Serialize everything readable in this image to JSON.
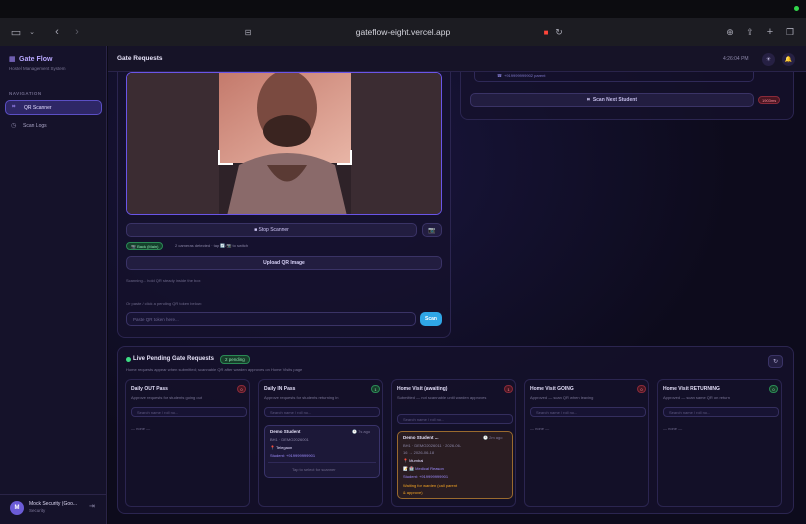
{
  "browser": {
    "url": "gateflow-eight.vercel.app"
  },
  "sidebar": {
    "brand": "Gate Flow",
    "brand_sub": "Hostel Management System",
    "nav_label": "NAVIGATION",
    "items": [
      {
        "label": "QR Scanner",
        "icon": "qr-icon",
        "active": true
      },
      {
        "label": "Scan Logs",
        "icon": "clock-icon",
        "active": false
      }
    ],
    "user": {
      "initial": "M",
      "name": "Mock Security (Goo...",
      "role": "Security"
    }
  },
  "header": {
    "title": "Gate Requests",
    "time": "4:26:04 PM"
  },
  "scanner": {
    "stop_label": "■ Stop Scanner",
    "camera_badge": "📷 Back (Main)",
    "camera_info": "2 cameras detected · tap 🔄/📷 to switch",
    "upload_label": "Upload QR Image",
    "hint": "Scanning... hold QR steady inside the box",
    "paste_label": "Or paste / click a pending QR token below:",
    "token_placeholder": "Paste QR token here...",
    "scan_label": "Scan"
  },
  "result": {
    "parent_line": "+919999999902 parent",
    "next_label": "Scan Next Student",
    "timer": "1903ms"
  },
  "live": {
    "title": "Live Pending Gate Requests",
    "badge": "2 pending",
    "subtitle": "Home requests appear when submitted; scannable QR after warden approves on Home Visits page",
    "columns": [
      {
        "title": "Daily OUT Pass",
        "count": "0",
        "sub": "Approve requests for students going out",
        "search": "Search name / roll no...",
        "empty": "— none —"
      },
      {
        "title": "Daily IN Pass",
        "count": "1",
        "sub": "Approve requests for students returning in",
        "search": "Search name / roll no..."
      },
      {
        "title": "Home Visit (awaiting)",
        "count": "1",
        "sub": "Submitted — not scannable until warden approves",
        "search": "Search name / roll no..."
      },
      {
        "title": "Home Visit GOING",
        "count": "0",
        "sub": "Approved — scan QR when leaving",
        "search": "Search name / roll no...",
        "empty": "— none —"
      },
      {
        "title": "Home Visit RETURNING",
        "count": "0",
        "sub": "Approved — scan same QR on return",
        "search": "Search name / roll no...",
        "empty": "— none —"
      }
    ],
    "in_card": {
      "name": "Demo Student",
      "ago": "🕓 7s ago",
      "room": "BH1 · DEMO2026001",
      "place": "📍 Telegaon",
      "student": "Student: +919999999901",
      "tap": "Tap to select for scanner"
    },
    "home_card": {
      "name": "Demo Student ...",
      "ago": "🕓 2m ago",
      "room": "BH1 · DEMO2026011 · 2026-06-",
      "dates": "16 → 2026-06-18",
      "place": "📍 Mumbai",
      "reason": "📝 🏥 Medical Reason",
      "student": "Student: +919999999901",
      "waiting1": "Waiting for warden (call parent",
      "waiting2": "& approve)"
    }
  },
  "colors": {
    "accent": "#6a55e8",
    "scan_blue": "#2fa6e6",
    "pending_green": "#3ddc84",
    "warning_orange": "#f5a524"
  }
}
